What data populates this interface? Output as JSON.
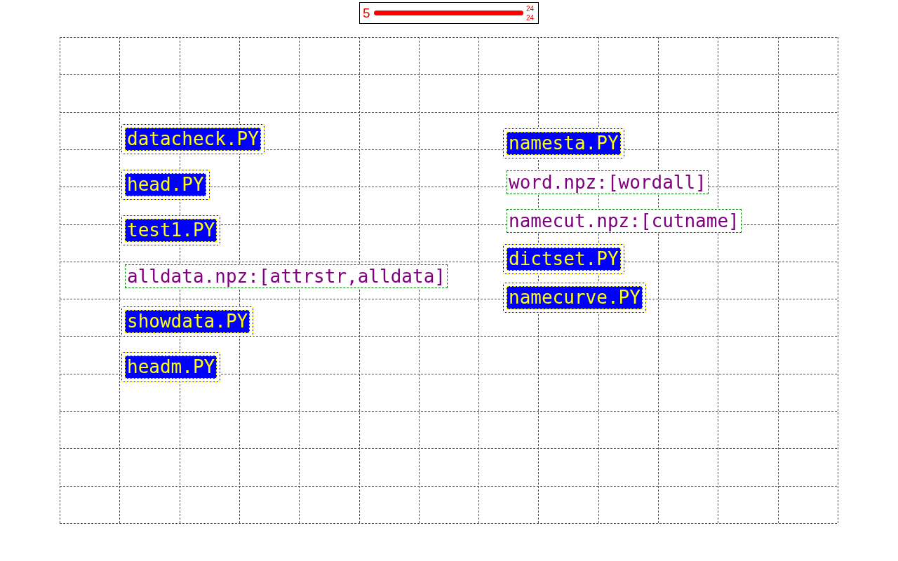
{
  "range_bar": {
    "min_label": "5",
    "level": 1,
    "upper_label": "24",
    "lower_label": "24"
  },
  "canvas": {
    "columns": [
      {
        "nodes": [
          {
            "kind": "script",
            "label": "datacheck.PY"
          },
          {
            "kind": "script",
            "label": "head.PY"
          },
          {
            "kind": "script",
            "label": "test1.PY"
          },
          {
            "kind": "data",
            "label": "alldata.npz:[attrstr,alldata]"
          },
          {
            "kind": "script",
            "label": "showdata.PY"
          },
          {
            "kind": "script",
            "label": "headm.PY"
          }
        ]
      },
      {
        "nodes": [
          {
            "kind": "script",
            "label": "namesta.PY"
          },
          {
            "kind": "data",
            "label": "word.npz:[wordall]"
          },
          {
            "kind": "data",
            "label": "namecut.npz:[cutname]"
          },
          {
            "kind": "script",
            "label": "dictset.PY"
          },
          {
            "kind": "script",
            "label": "namecurve.PY"
          }
        ]
      }
    ]
  }
}
